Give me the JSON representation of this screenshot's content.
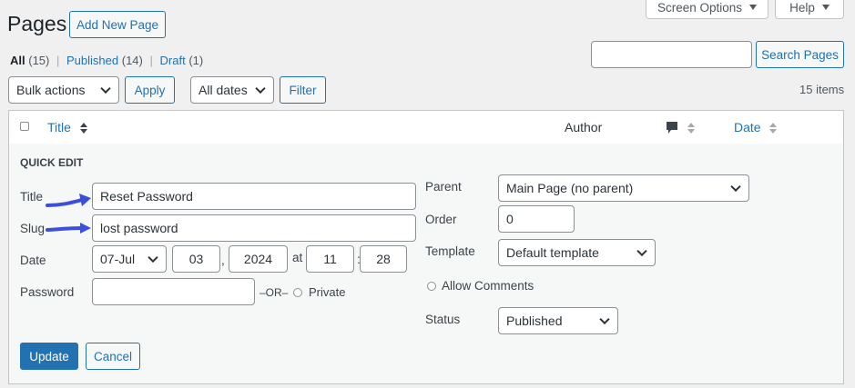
{
  "page_title": "Pages",
  "add_new_label": "Add New Page",
  "screen_options_label": "Screen Options",
  "help_label": "Help",
  "filters": {
    "all_label": "All",
    "all_count": "(15)",
    "published_label": "Published",
    "published_count": "(14)",
    "draft_label": "Draft",
    "draft_count": "(1)",
    "separator": "|"
  },
  "search": {
    "value": "",
    "button_label": "Search Pages"
  },
  "bulk": {
    "selected": "Bulk actions",
    "apply_label": "Apply"
  },
  "dates": {
    "selected": "All dates",
    "filter_label": "Filter"
  },
  "items_count": "15 items",
  "table": {
    "col_title": "Title",
    "col_author": "Author",
    "col_comments_icon": "comment-bubble-icon",
    "col_date": "Date"
  },
  "quick_edit": {
    "heading": "QUICK EDIT",
    "title_label": "Title",
    "title_value": "Reset Password",
    "slug_label": "Slug",
    "slug_value": "lost password",
    "date_label": "Date",
    "month_value": "07-Jul",
    "day_value": "03",
    "comma": ",",
    "year_value": "2024",
    "at_label": "at",
    "hour_value": "11",
    "colon": ":",
    "minute_value": "28",
    "password_label": "Password",
    "password_value": "",
    "or_label": "–OR–",
    "private_label": "Private",
    "parent_label": "Parent",
    "parent_value": "Main Page (no parent)",
    "order_label": "Order",
    "order_value": "0",
    "template_label": "Template",
    "template_value": "Default template",
    "allow_comments_label": "Allow Comments",
    "status_label": "Status",
    "status_value": "Published",
    "update_label": "Update",
    "cancel_label": "Cancel"
  },
  "colors": {
    "accent": "#2271b1",
    "arrow": "#3b4fd8",
    "background": "#f0f0f1"
  }
}
